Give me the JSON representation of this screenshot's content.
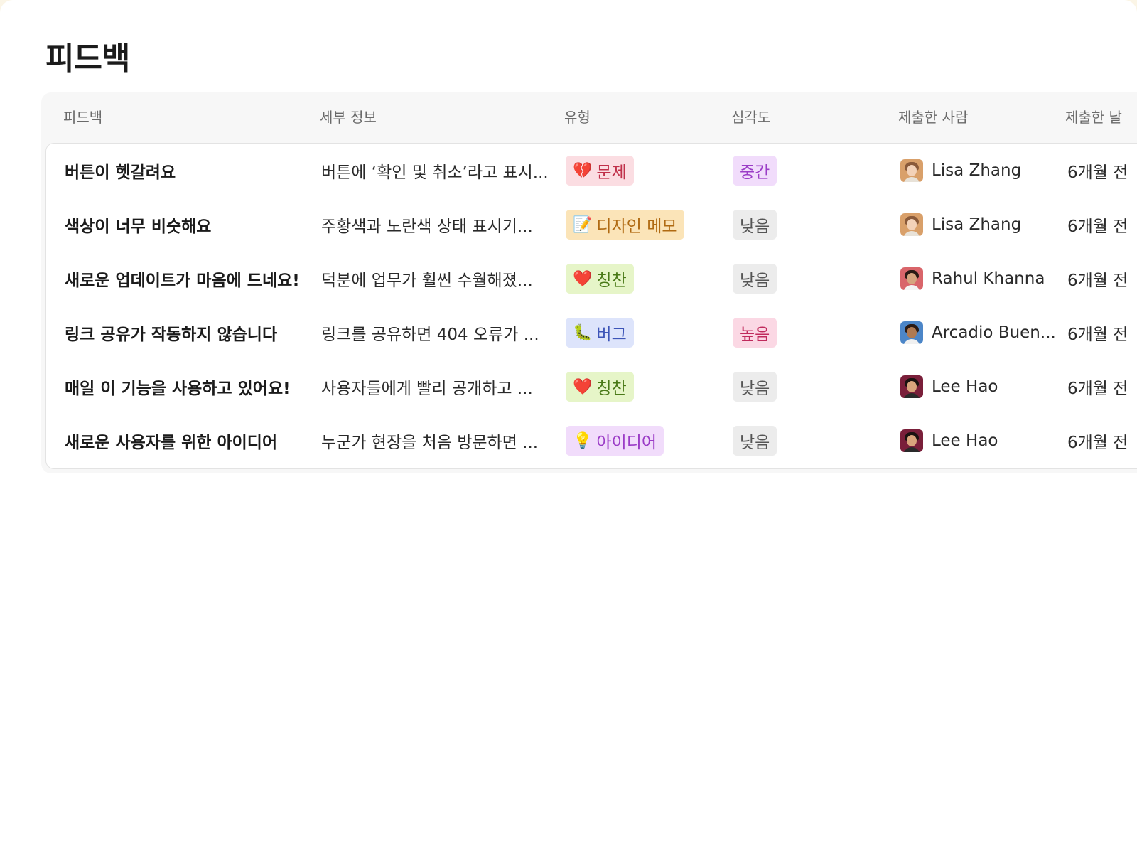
{
  "page": {
    "title": "피드백"
  },
  "table": {
    "columns": [
      {
        "key": "title",
        "label": "피드백"
      },
      {
        "key": "details",
        "label": "세부 정보"
      },
      {
        "key": "type",
        "label": "유형"
      },
      {
        "key": "severity",
        "label": "심각도"
      },
      {
        "key": "submitter",
        "label": "제출한 사람"
      },
      {
        "key": "date",
        "label": "제출한 날"
      }
    ],
    "rows": [
      {
        "title": "버튼이 헷갈려요",
        "details": "버튼에 ‘확인 및 취소’라고 표시...",
        "type": {
          "emoji": "💔",
          "label": "문제",
          "bg": "#fbdde2",
          "fg": "#c0304a"
        },
        "severity": {
          "label": "중간",
          "bg": "#f1dcfb",
          "fg": "#9b3cc7"
        },
        "submitter": {
          "name": "Lisa Zhang",
          "avatar_bg": "#d9a06a",
          "hair": "#8a5a3a",
          "skin": "#f3d2b8",
          "shirt": "#e8e2d8"
        },
        "date": "6개월 전"
      },
      {
        "title": "색상이 너무 비슷해요",
        "details": "주황색과 노란색 상태 표시기...",
        "type": {
          "emoji": "📝",
          "label": "디자인 메모",
          "bg": "#fbe4b8",
          "fg": "#b06a12"
        },
        "severity": {
          "label": "낮음",
          "bg": "#ececec",
          "fg": "#555555"
        },
        "submitter": {
          "name": "Lisa Zhang",
          "avatar_bg": "#d9a06a",
          "hair": "#8a5a3a",
          "skin": "#f3d2b8",
          "shirt": "#e8e2d8"
        },
        "date": "6개월 전"
      },
      {
        "title": "새로운 업데이트가 마음에 드네요!",
        "details": "덕분에 업무가 훨씬 수월해졌...",
        "type": {
          "emoji": "❤️",
          "label": "칭찬",
          "bg": "#e6f5c8",
          "fg": "#4a7a18"
        },
        "severity": {
          "label": "낮음",
          "bg": "#ececec",
          "fg": "#555555"
        },
        "submitter": {
          "name": "Rahul Khanna",
          "avatar_bg": "#d9656a",
          "hair": "#2a1a14",
          "skin": "#d6a47e",
          "shirt": "#f4f4f4"
        },
        "date": "6개월 전"
      },
      {
        "title": "링크 공유가 작동하지 않습니다",
        "details": "링크를 공유하면 404 오류가 ...",
        "type": {
          "emoji": "🐛",
          "label": "버그",
          "bg": "#dde4fb",
          "fg": "#3d55b8"
        },
        "severity": {
          "label": "높음",
          "bg": "#fbd8e4",
          "fg": "#c02a5c"
        },
        "submitter": {
          "name": "Arcadio Buen...",
          "avatar_bg": "#4c86c8",
          "hair": "#2a1a14",
          "skin": "#b07a52",
          "shirt": "#f1f1f1"
        },
        "date": "6개월 전"
      },
      {
        "title": "매일 이 기능을 사용하고 있어요!",
        "details": "사용자들에게 빨리 공개하고 ...",
        "type": {
          "emoji": "❤️",
          "label": "칭찬",
          "bg": "#e6f5c8",
          "fg": "#4a7a18"
        },
        "severity": {
          "label": "낮음",
          "bg": "#ececec",
          "fg": "#555555"
        },
        "submitter": {
          "name": "Lee Hao",
          "avatar_bg": "#7a1f3a",
          "hair": "#1a1210",
          "skin": "#d9a47c",
          "shirt": "#2a2a2a"
        },
        "date": "6개월 전"
      },
      {
        "title": "새로운 사용자를 위한 아이디어",
        "details": "누군가 현장을 처음 방문하면 ...",
        "type": {
          "emoji": "💡",
          "label": "아이디어",
          "bg": "#f1dcfb",
          "fg": "#9b3cc7"
        },
        "severity": {
          "label": "낮음",
          "bg": "#ececec",
          "fg": "#555555"
        },
        "submitter": {
          "name": "Lee Hao",
          "avatar_bg": "#7a1f3a",
          "hair": "#1a1210",
          "skin": "#d9a47c",
          "shirt": "#2a2a2a"
        },
        "date": "6개월 전"
      }
    ]
  }
}
